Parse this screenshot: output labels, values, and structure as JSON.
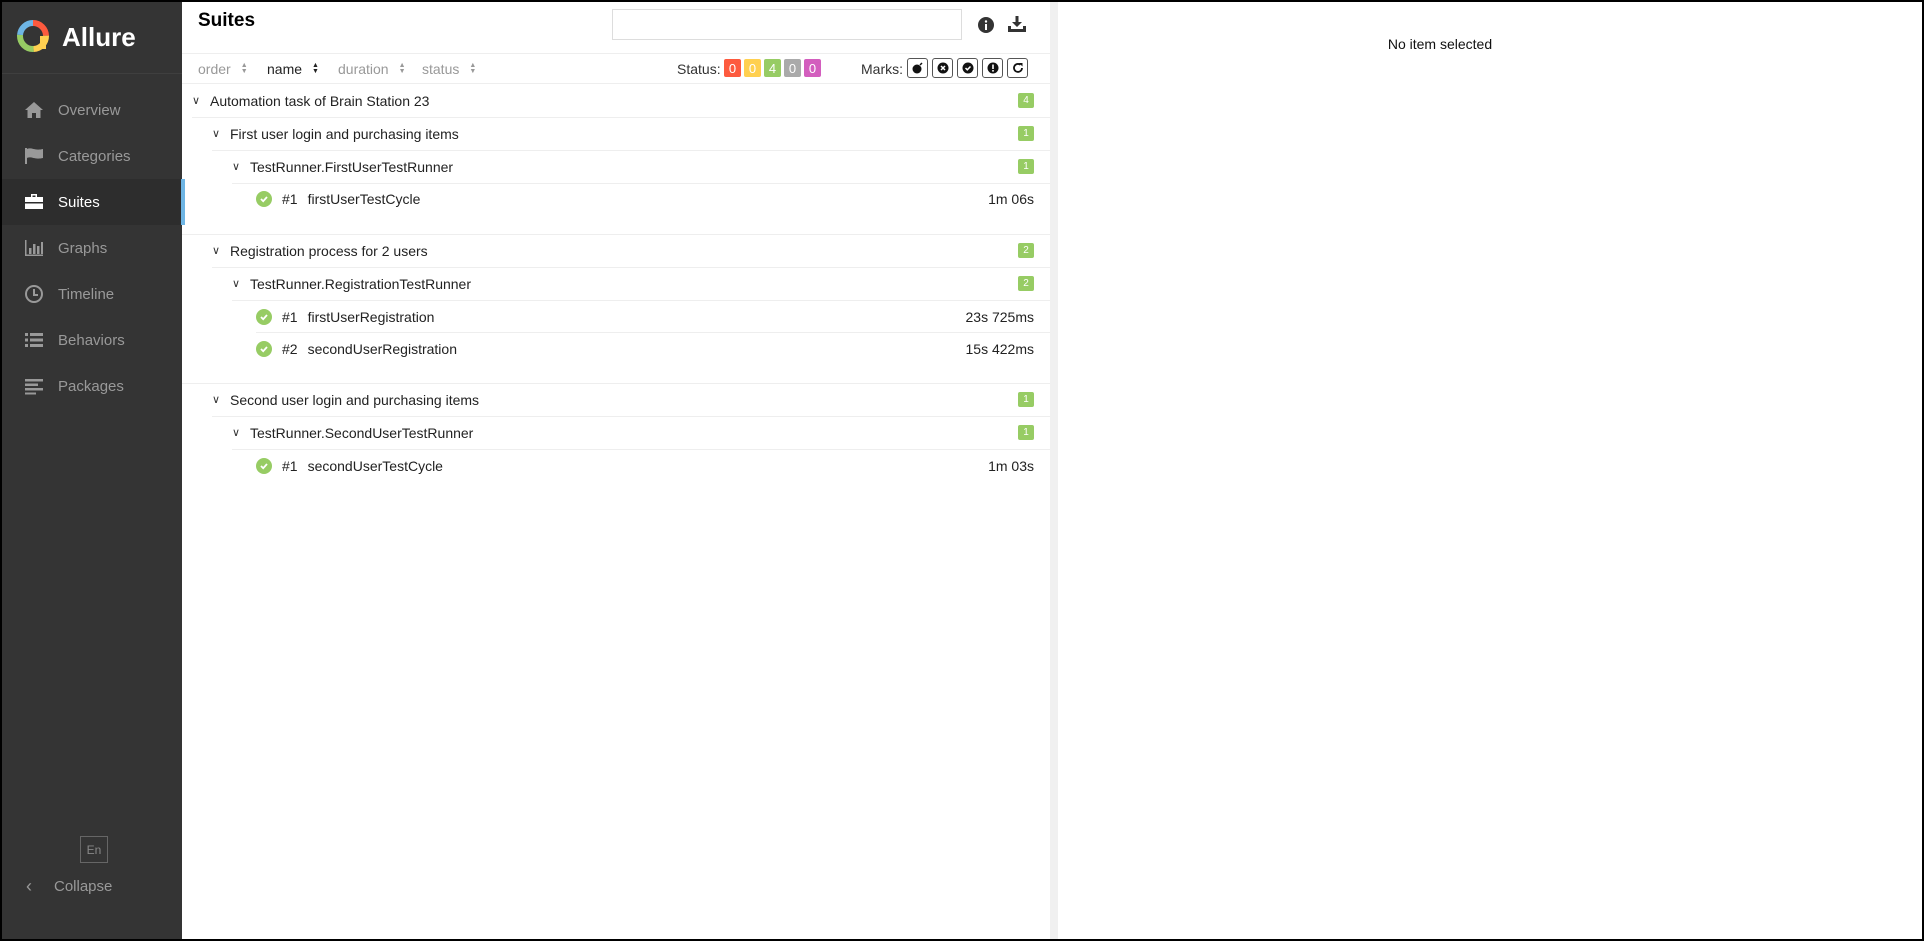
{
  "app": {
    "name": "Allure"
  },
  "sidebar": {
    "items": [
      {
        "label": "Overview",
        "icon": "home-icon"
      },
      {
        "label": "Categories",
        "icon": "flag-icon"
      },
      {
        "label": "Suites",
        "icon": "briefcase-icon",
        "active": true
      },
      {
        "label": "Graphs",
        "icon": "bar-chart-icon"
      },
      {
        "label": "Timeline",
        "icon": "clock-icon"
      },
      {
        "label": "Behaviors",
        "icon": "list-icon"
      },
      {
        "label": "Packages",
        "icon": "align-left-icon"
      }
    ],
    "language": "En",
    "collapse_label": "Collapse"
  },
  "pane": {
    "title": "Suites",
    "search": {
      "placeholder": "",
      "value": ""
    },
    "sort": {
      "order": "order",
      "name": "name",
      "duration": "duration",
      "status": "status"
    },
    "status_label": "Status:",
    "status_counts": [
      {
        "value": "0",
        "color": "#fd5a3e"
      },
      {
        "value": "0",
        "color": "#ffd050"
      },
      {
        "value": "4",
        "color": "#97cc64"
      },
      {
        "value": "0",
        "color": "#aaaaaa"
      },
      {
        "value": "0",
        "color": "#d35ebe"
      }
    ],
    "marks_label": "Marks:"
  },
  "tree": {
    "root": {
      "name": "Automation task of Brain Station 23",
      "count": "4"
    },
    "suites": [
      {
        "name": "First user login and purchasing items",
        "count": "1",
        "classname": "TestRunner.FirstUserTestRunner",
        "class_count": "1",
        "tests": [
          {
            "num": "#1",
            "name": "firstUserTestCycle",
            "duration": "1m 06s"
          }
        ]
      },
      {
        "name": "Registration process for 2 users",
        "count": "2",
        "classname": "TestRunner.RegistrationTestRunner",
        "class_count": "2",
        "tests": [
          {
            "num": "#1",
            "name": "firstUserRegistration",
            "duration": "23s 725ms"
          },
          {
            "num": "#2",
            "name": "secondUserRegistration",
            "duration": "15s 422ms"
          }
        ]
      },
      {
        "name": "Second user login and purchasing items",
        "count": "1",
        "classname": "TestRunner.SecondUserTestRunner",
        "class_count": "1",
        "tests": [
          {
            "num": "#1",
            "name": "secondUserTestCycle",
            "duration": "1m 03s"
          }
        ]
      }
    ]
  },
  "details": {
    "empty_text": "No item selected"
  },
  "colors": {
    "sidebar_bg": "#343434",
    "accent": "#6eb5e4",
    "passed": "#97cc64"
  }
}
